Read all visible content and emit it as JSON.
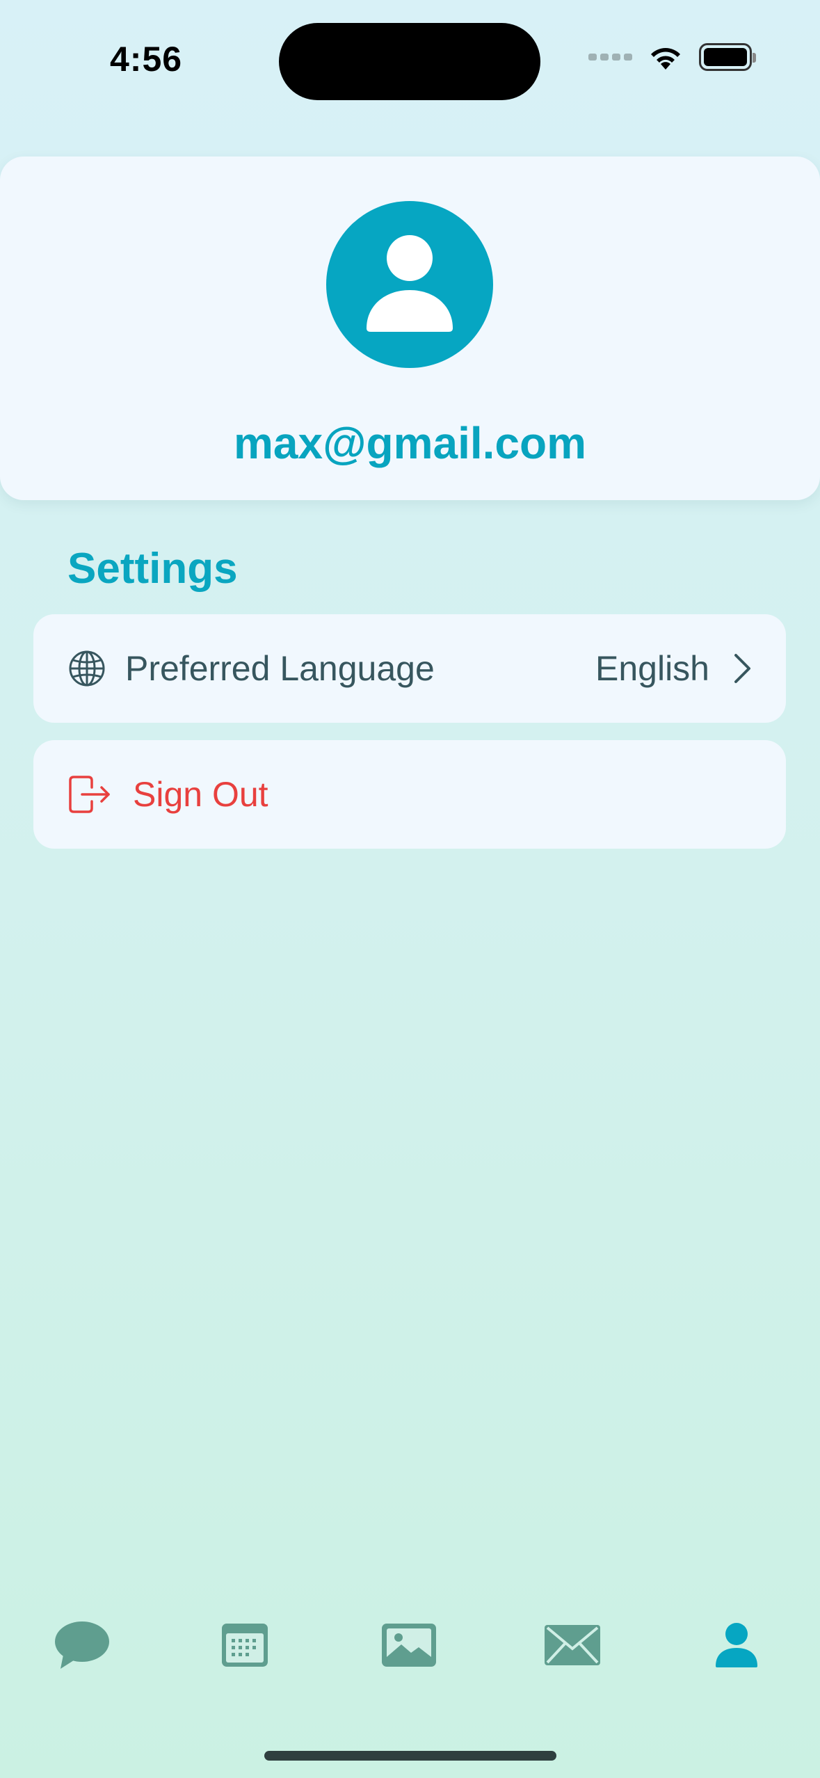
{
  "status_bar": {
    "time": "4:56"
  },
  "profile": {
    "email": "max@gmail.com",
    "avatar_icon": "person-icon",
    "accent_color": "#06a6c2"
  },
  "settings": {
    "heading": "Settings",
    "language": {
      "label": "Preferred Language",
      "value": "English",
      "icon": "globe-icon"
    },
    "sign_out": {
      "label": "Sign Out",
      "icon": "sign-out-icon",
      "color": "#e8403e"
    }
  },
  "tab_bar": {
    "active_tab": "profile",
    "active_color": "#06a6c2",
    "inactive_color": "#5f9e8f",
    "tabs": [
      {
        "id": "chat",
        "icon": "chat-bubble-icon"
      },
      {
        "id": "calendar",
        "icon": "calendar-icon"
      },
      {
        "id": "gallery",
        "icon": "photo-icon"
      },
      {
        "id": "mail",
        "icon": "envelope-icon"
      },
      {
        "id": "profile",
        "icon": "person-icon"
      }
    ]
  }
}
